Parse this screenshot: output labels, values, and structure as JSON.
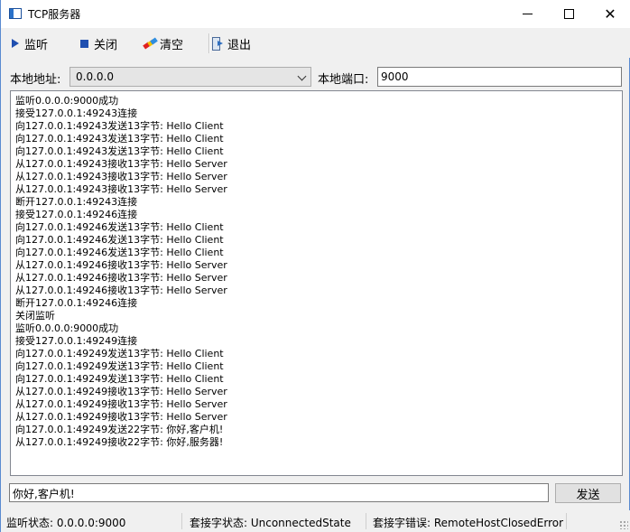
{
  "window": {
    "title": "TCP服务器"
  },
  "toolbar": {
    "listen": "监听",
    "close": "关闭",
    "clear": "清空",
    "exit": "退出"
  },
  "address": {
    "label": "本地地址:",
    "value": "0.0.0.0",
    "port_label": "本地端口:",
    "port_value": "9000"
  },
  "log": [
    "监听0.0.0.0:9000成功",
    "接受127.0.0.1:49243连接",
    "向127.0.0.1:49243发送13字节: Hello Client",
    "向127.0.0.1:49243发送13字节: Hello Client",
    "向127.0.0.1:49243发送13字节: Hello Client",
    "从127.0.0.1:49243接收13字节: Hello Server",
    "从127.0.0.1:49243接收13字节: Hello Server",
    "从127.0.0.1:49243接收13字节: Hello Server",
    "断开127.0.0.1:49243连接",
    "接受127.0.0.1:49246连接",
    "向127.0.0.1:49246发送13字节: Hello Client",
    "向127.0.0.1:49246发送13字节: Hello Client",
    "向127.0.0.1:49246发送13字节: Hello Client",
    "从127.0.0.1:49246接收13字节: Hello Server",
    "从127.0.0.1:49246接收13字节: Hello Server",
    "从127.0.0.1:49246接收13字节: Hello Server",
    "断开127.0.0.1:49246连接",
    "关闭监听",
    "监听0.0.0.0:9000成功",
    "接受127.0.0.1:49249连接",
    "向127.0.0.1:49249发送13字节: Hello Client",
    "向127.0.0.1:49249发送13字节: Hello Client",
    "向127.0.0.1:49249发送13字节: Hello Client",
    "从127.0.0.1:49249接收13字节: Hello Server",
    "从127.0.0.1:49249接收13字节: Hello Server",
    "从127.0.0.1:49249接收13字节: Hello Server",
    "向127.0.0.1:49249发送22字节: 你好,客户机!",
    "从127.0.0.1:49249接收22字节: 你好,服务器!"
  ],
  "send": {
    "message": "你好,客户机!",
    "button": "发送"
  },
  "status": {
    "listen": "监听状态: 0.0.0.0:9000",
    "socket_state": "套接字状态: UnconnectedState",
    "socket_error": "套接字错误: RemoteHostClosedError"
  },
  "icons": {
    "listen": "play-icon",
    "close": "stop-icon",
    "clear": "eraser-icon",
    "exit": "exit-door-icon"
  }
}
